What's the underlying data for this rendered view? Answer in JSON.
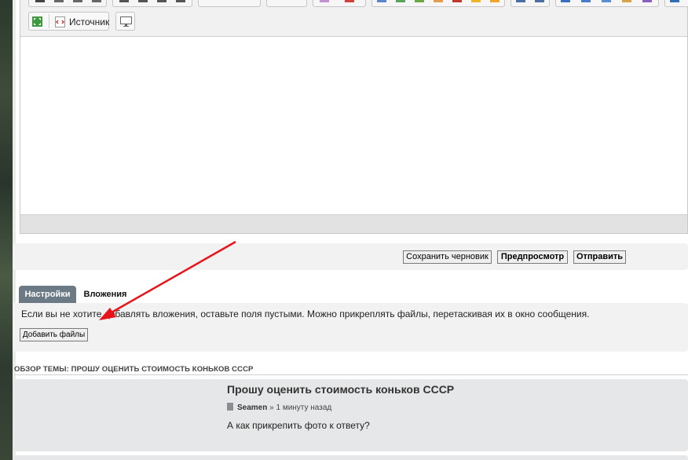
{
  "editor": {
    "source_label": "Источник"
  },
  "actions": {
    "save_draft": "Сохранить черновик",
    "preview": "Предпросмотр",
    "submit": "Отправить"
  },
  "tabs": [
    {
      "label": "Настройки",
      "active": true
    },
    {
      "label": "Вложения",
      "active": false
    }
  ],
  "attachments": {
    "hint": "Если вы не хотите добавлять вложения, оставьте поля пустыми. Можно прикреплять файлы, перетаскивая их в окно сообщения.",
    "add_files": "Добавить файлы"
  },
  "review": {
    "heading": "Обзор темы: Прошу оценить стоимость коньков СССР",
    "post": {
      "title": "Прошу оценить стоимость коньков СССР",
      "author": "Seamen",
      "separator": "»",
      "time": "1 минуту назад",
      "body": "А как прикрепить фото к ответу?"
    }
  },
  "annotation": {
    "color": "#e8141a"
  },
  "colors": {
    "active_tab": "#6c7a86",
    "panel_bg": "#f2f2f2",
    "post_bg": "#e6e7e8"
  }
}
